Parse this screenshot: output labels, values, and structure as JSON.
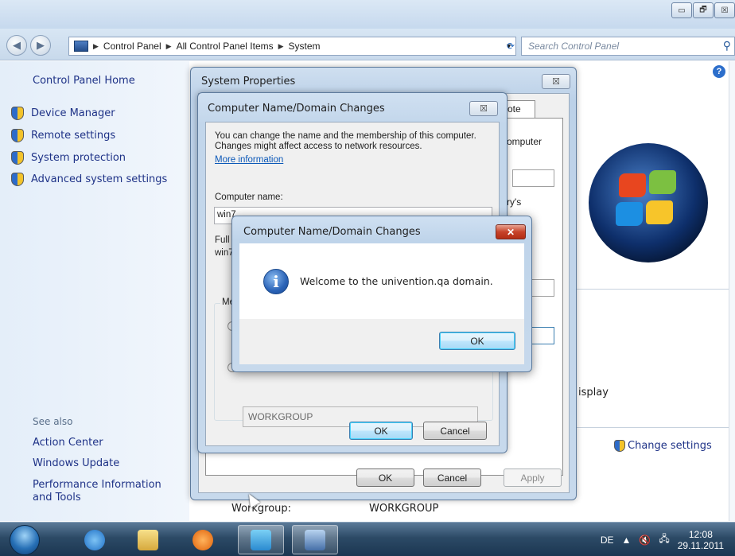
{
  "address_bar": {
    "crumbs": [
      "Control Panel",
      "All Control Panel Items",
      "System"
    ],
    "search_placeholder": "Search Control Panel"
  },
  "window_buttons": {
    "minimize": "▭",
    "maximize": "🗗",
    "close": "☒"
  },
  "left_nav": {
    "home": "Control Panel Home",
    "items": [
      "Device Manager",
      "Remote settings",
      "System protection",
      "Advanced system settings"
    ],
    "see_also_label": "See also",
    "see_also": [
      "Action Center",
      "Windows Update",
      "Performance Information and Tools"
    ]
  },
  "background": {
    "help": "?",
    "partial_texts": [
      "isplay"
    ],
    "change_settings": "Change settings",
    "workgroup_label": "Workgroup:",
    "workgroup_value": "WORKGROUP"
  },
  "system_properties": {
    "title": "System Properties",
    "close": "☒",
    "tab_fragment": "ote",
    "fragments": [
      "omputer",
      "ry's"
    ],
    "ok": "OK",
    "cancel": "Cancel",
    "apply": "Apply"
  },
  "computer_name_dialog": {
    "title": "Computer Name/Domain Changes",
    "close": "☒",
    "description": "You can change the name and the membership of this computer. Changes might affect access to network resources.",
    "more_info": "More information",
    "computer_name_label": "Computer name:",
    "computer_name_value": "win7",
    "full_name_fragment": "Full c",
    "full_name_value_fragment": "win7",
    "member_of_fragment": "Me",
    "workgroup_value": "WORKGROUP",
    "ok": "OK",
    "cancel": "Cancel"
  },
  "message_box": {
    "title": "Computer Name/Domain Changes",
    "close": "✕",
    "icon": "i",
    "text": "Welcome to the univention.qa domain.",
    "ok": "OK"
  },
  "taskbar": {
    "language": "DE",
    "time": "12:08",
    "date": "29.11.2011"
  }
}
